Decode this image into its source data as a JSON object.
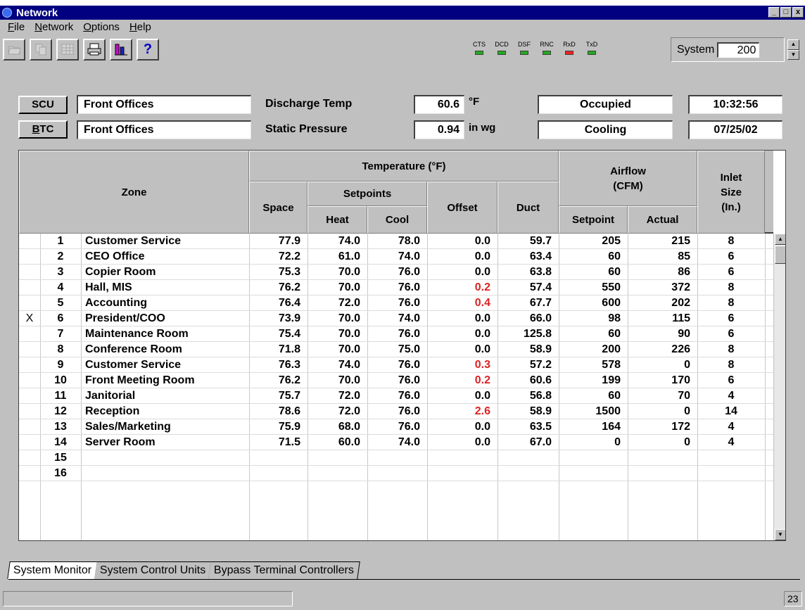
{
  "window": {
    "title": "Network",
    "min": "_",
    "max": "□",
    "close": "x"
  },
  "menu": [
    {
      "label": "File",
      "key": "F",
      "rest": "ile"
    },
    {
      "label": "Network",
      "key": "N",
      "rest": "etwork"
    },
    {
      "label": "Options",
      "key": "O",
      "rest": "ptions"
    },
    {
      "label": "Help",
      "key": "H",
      "rest": "elp"
    }
  ],
  "toolbar": {
    "help_label": "?"
  },
  "leds": [
    {
      "label": "CTS",
      "color": "#22aa22"
    },
    {
      "label": "DCD",
      "color": "#22aa22"
    },
    {
      "label": "DSF",
      "color": "#22aa22"
    },
    {
      "label": "RNC",
      "color": "#22aa22"
    },
    {
      "label": "RxD",
      "color": "#ee2222"
    },
    {
      "label": "TxD",
      "color": "#22aa22"
    }
  ],
  "system": {
    "label": "System",
    "value": "200"
  },
  "status": {
    "scu_button": "SCU",
    "scu_name": "Front Offices",
    "btc_button": "BTC",
    "btc_name": "Front Offices",
    "discharge_label": "Discharge Temp",
    "discharge_value": "60.6",
    "discharge_unit": "°F",
    "static_label": "Static Pressure",
    "static_value": "0.94",
    "static_unit": "in wg",
    "occupancy": "Occupied",
    "mode": "Cooling",
    "time": "10:32:56",
    "date": "07/25/02"
  },
  "table": {
    "headers": {
      "zone": "Zone",
      "temperature": "Temperature  (°F)",
      "space": "Space",
      "setpoints": "Setpoints",
      "heat": "Heat",
      "cool": "Cool",
      "offset": "Offset",
      "duct": "Duct",
      "airflow": "Airflow\n(CFM)",
      "airflow_setpoint": "Setpoint",
      "airflow_actual": "Actual",
      "inlet": "Inlet\nSize\n(In.)"
    },
    "rows": [
      {
        "mark": "",
        "num": "1",
        "zone": "Customer Service",
        "space": "77.9",
        "heat": "74.0",
        "cool": "78.0",
        "offset": "0.0",
        "offset_alert": false,
        "duct": "59.7",
        "af_set": "205",
        "af_act": "215",
        "inlet": "8"
      },
      {
        "mark": "",
        "num": "2",
        "zone": "CEO Office",
        "space": "72.2",
        "heat": "61.0",
        "cool": "74.0",
        "offset": "0.0",
        "offset_alert": false,
        "duct": "63.4",
        "af_set": "60",
        "af_act": "85",
        "inlet": "6"
      },
      {
        "mark": "",
        "num": "3",
        "zone": "Copier Room",
        "space": "75.3",
        "heat": "70.0",
        "cool": "76.0",
        "offset": "0.0",
        "offset_alert": false,
        "duct": "63.8",
        "af_set": "60",
        "af_act": "86",
        "inlet": "6"
      },
      {
        "mark": "",
        "num": "4",
        "zone": "Hall, MIS",
        "space": "76.2",
        "heat": "70.0",
        "cool": "76.0",
        "offset": "0.2",
        "offset_alert": true,
        "duct": "57.4",
        "af_set": "550",
        "af_act": "372",
        "inlet": "8"
      },
      {
        "mark": "",
        "num": "5",
        "zone": "Accounting",
        "space": "76.4",
        "heat": "72.0",
        "cool": "76.0",
        "offset": "0.4",
        "offset_alert": true,
        "duct": "67.7",
        "af_set": "600",
        "af_act": "202",
        "inlet": "8"
      },
      {
        "mark": "X",
        "num": "6",
        "zone": "President/COO",
        "space": "73.9",
        "heat": "70.0",
        "cool": "74.0",
        "offset": "0.0",
        "offset_alert": false,
        "duct": "66.0",
        "af_set": "98",
        "af_act": "115",
        "inlet": "6"
      },
      {
        "mark": "",
        "num": "7",
        "zone": "Maintenance Room",
        "space": "75.4",
        "heat": "70.0",
        "cool": "76.0",
        "offset": "0.0",
        "offset_alert": false,
        "duct": "125.8",
        "af_set": "60",
        "af_act": "90",
        "inlet": "6"
      },
      {
        "mark": "",
        "num": "8",
        "zone": "Conference Room",
        "space": "71.8",
        "heat": "70.0",
        "cool": "75.0",
        "offset": "0.0",
        "offset_alert": false,
        "duct": "58.9",
        "af_set": "200",
        "af_act": "226",
        "inlet": "8"
      },
      {
        "mark": "",
        "num": "9",
        "zone": "Customer Service",
        "space": "76.3",
        "heat": "74.0",
        "cool": "76.0",
        "offset": "0.3",
        "offset_alert": true,
        "duct": "57.2",
        "af_set": "578",
        "af_act": "0",
        "inlet": "8"
      },
      {
        "mark": "",
        "num": "10",
        "zone": "Front Meeting Room",
        "space": "76.2",
        "heat": "70.0",
        "cool": "76.0",
        "offset": "0.2",
        "offset_alert": true,
        "duct": "60.6",
        "af_set": "199",
        "af_act": "170",
        "inlet": "6"
      },
      {
        "mark": "",
        "num": "11",
        "zone": "Janitorial",
        "space": "75.7",
        "heat": "72.0",
        "cool": "76.0",
        "offset": "0.0",
        "offset_alert": false,
        "duct": "56.8",
        "af_set": "60",
        "af_act": "70",
        "inlet": "4"
      },
      {
        "mark": "",
        "num": "12",
        "zone": "Reception",
        "space": "78.6",
        "heat": "72.0",
        "cool": "76.0",
        "offset": "2.6",
        "offset_alert": true,
        "duct": "58.9",
        "af_set": "1500",
        "af_act": "0",
        "inlet": "14"
      },
      {
        "mark": "",
        "num": "13",
        "zone": "Sales/Marketing",
        "space": "75.9",
        "heat": "68.0",
        "cool": "76.0",
        "offset": "0.0",
        "offset_alert": false,
        "duct": "63.5",
        "af_set": "164",
        "af_act": "172",
        "inlet": "4"
      },
      {
        "mark": "",
        "num": "14",
        "zone": "Server Room",
        "space": "71.5",
        "heat": "60.0",
        "cool": "74.0",
        "offset": "0.0",
        "offset_alert": false,
        "duct": "67.0",
        "af_set": "0",
        "af_act": "0",
        "inlet": "4"
      },
      {
        "mark": "",
        "num": "15",
        "zone": "",
        "space": "",
        "heat": "",
        "cool": "",
        "offset": "",
        "offset_alert": false,
        "duct": "",
        "af_set": "",
        "af_act": "",
        "inlet": ""
      },
      {
        "mark": "",
        "num": "16",
        "zone": "",
        "space": "",
        "heat": "",
        "cool": "",
        "offset": "",
        "offset_alert": false,
        "duct": "",
        "af_set": "",
        "af_act": "",
        "inlet": ""
      }
    ]
  },
  "tabs": [
    {
      "label": "System Monitor",
      "active": true
    },
    {
      "label": "System Control Units",
      "active": false
    },
    {
      "label": "Bypass Terminal Controllers",
      "active": false
    }
  ],
  "statusbar": {
    "right": "23"
  },
  "colors": {
    "titlebar": "#000080",
    "alert": "#dd2222",
    "led_ok": "#22aa22",
    "led_err": "#ee2222"
  }
}
